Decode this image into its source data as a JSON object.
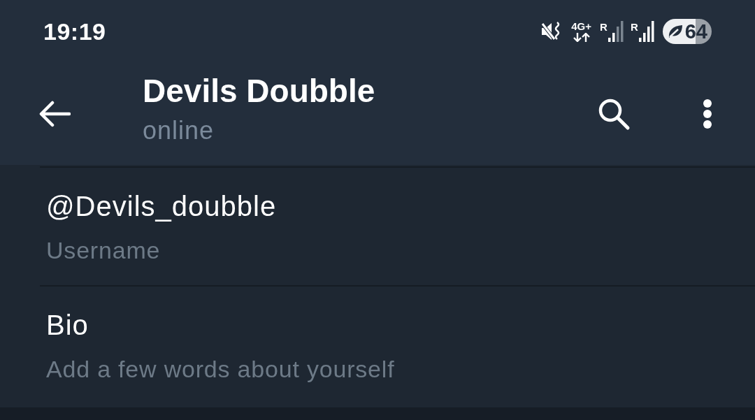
{
  "status_bar": {
    "time": "19:19",
    "network_type": "4G+",
    "sims": [
      {
        "roaming_label": "R",
        "kind": "weak"
      },
      {
        "roaming_label": "R",
        "kind": "strong"
      }
    ],
    "battery_percent": "64"
  },
  "header": {
    "title": "Devils Doubble",
    "subtitle": "online"
  },
  "info_rows": [
    {
      "text": "@Devils_doubble",
      "caption": "Username"
    },
    {
      "text": "Bio",
      "caption": "Add a few words about yourself"
    }
  ]
}
